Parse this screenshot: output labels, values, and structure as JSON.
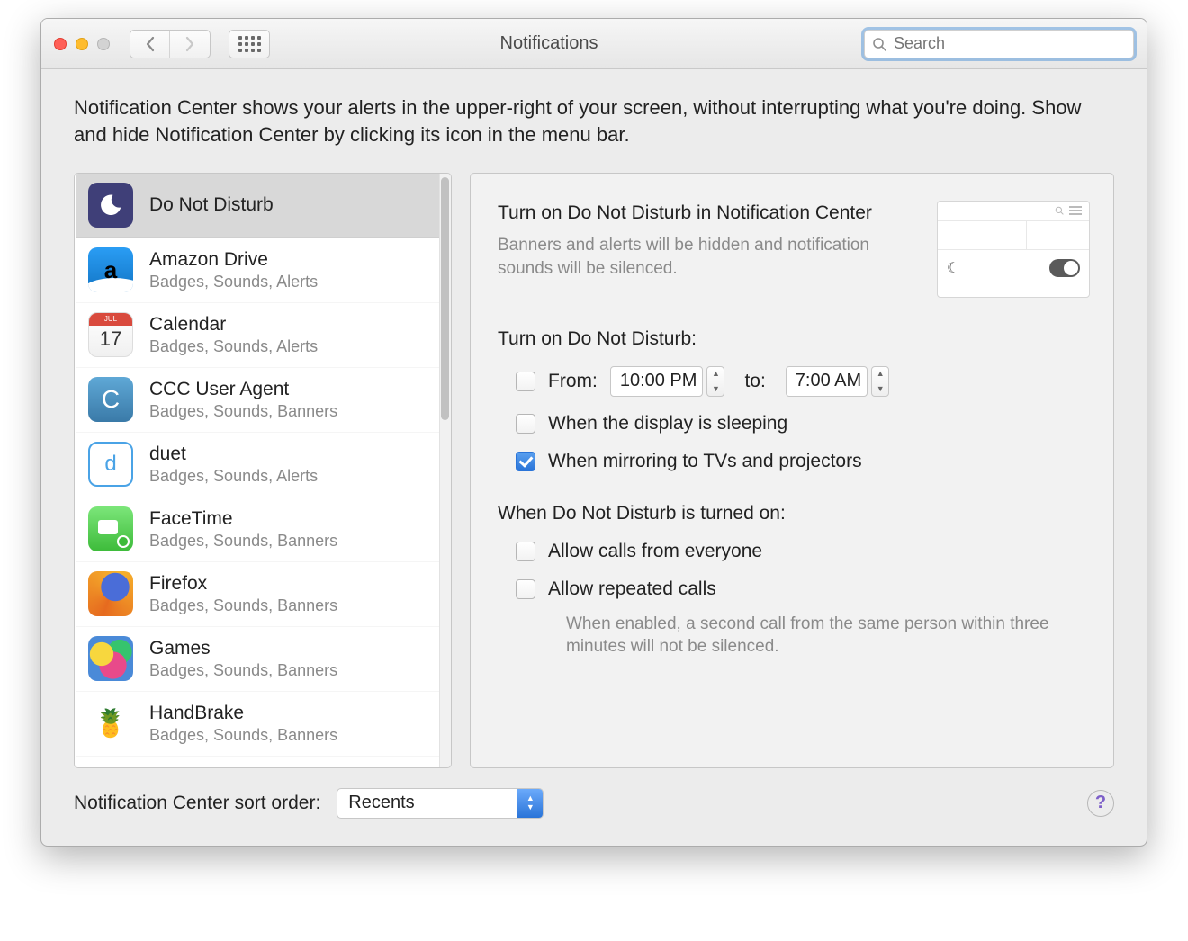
{
  "window": {
    "title": "Notifications"
  },
  "search": {
    "placeholder": "Search"
  },
  "intro": "Notification Center shows your alerts in the upper-right of your screen, without interrupting what you're doing. Show and hide Notification Center by clicking its icon in the menu bar.",
  "apps": [
    {
      "name": "Do Not Disturb",
      "sub": "",
      "selected": true,
      "icon": "dnd"
    },
    {
      "name": "Amazon Drive",
      "sub": "Badges, Sounds, Alerts",
      "icon": "amz"
    },
    {
      "name": "Calendar",
      "sub": "Badges, Sounds, Alerts",
      "icon": "cal"
    },
    {
      "name": "CCC User Agent",
      "sub": "Badges, Sounds, Banners",
      "icon": "ccc"
    },
    {
      "name": "duet",
      "sub": "Badges, Sounds, Alerts",
      "icon": "duet"
    },
    {
      "name": "FaceTime",
      "sub": "Badges, Sounds, Banners",
      "icon": "ft"
    },
    {
      "name": "Firefox",
      "sub": "Badges, Sounds, Banners",
      "icon": "ff"
    },
    {
      "name": "Games",
      "sub": "Badges, Sounds, Banners",
      "icon": "gm"
    },
    {
      "name": "HandBrake",
      "sub": "Badges, Sounds, Banners",
      "icon": "hb"
    }
  ],
  "calendar_icon": {
    "month": "JUL",
    "day": "17"
  },
  "dnd": {
    "title": "Turn on Do Not Disturb in Notification Center",
    "desc": "Banners and alerts will be hidden and notification sounds will be silenced.",
    "schedule_header": "Turn on Do Not Disturb:",
    "from_label": "From:",
    "from_value": "10:00 PM",
    "to_label": "to:",
    "to_value": "7:00 AM",
    "opt_sleep": "When the display is sleeping",
    "opt_mirror": "When mirroring to TVs and projectors",
    "on_header": "When Do Not Disturb is turned on:",
    "opt_everyone": "Allow calls from everyone",
    "opt_repeated": "Allow repeated calls",
    "repeated_hint": "When enabled, a second call from the same person within three minutes will not be silenced.",
    "from_checked": false,
    "sleep_checked": false,
    "mirror_checked": true,
    "everyone_checked": false,
    "repeated_checked": false
  },
  "footer": {
    "label": "Notification Center sort order:",
    "value": "Recents"
  }
}
